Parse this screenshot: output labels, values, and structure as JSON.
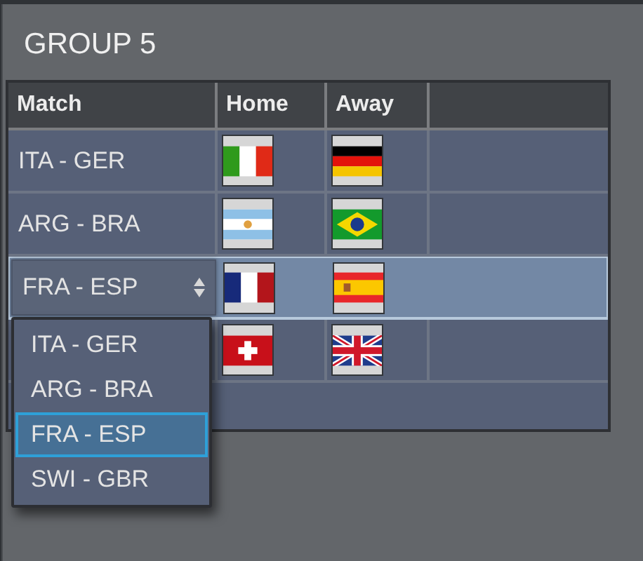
{
  "title": "GROUP 5",
  "table": {
    "columns": [
      "Match",
      "Home",
      "Away"
    ],
    "rows": [
      {
        "match": "ITA - GER",
        "home": {
          "kind": "italy"
        },
        "away": {
          "kind": "germany"
        },
        "selected": false
      },
      {
        "match": "ARG - BRA",
        "home": {
          "kind": "argentina"
        },
        "away": {
          "kind": "brazil"
        },
        "selected": false
      },
      {
        "match": "FRA - ESP",
        "home": {
          "kind": "france"
        },
        "away": {
          "kind": "spain"
        },
        "selected": true
      },
      {
        "home": {
          "kind": "switzerland"
        },
        "away": {
          "kind": "uk"
        },
        "selected": false
      }
    ]
  },
  "dropdown": {
    "options": [
      {
        "label": "ITA - GER",
        "selected": false
      },
      {
        "label": "ARG - BRA",
        "selected": false
      },
      {
        "label": "FRA - ESP",
        "selected": true
      },
      {
        "label": "SWI - GBR",
        "selected": false
      }
    ]
  }
}
